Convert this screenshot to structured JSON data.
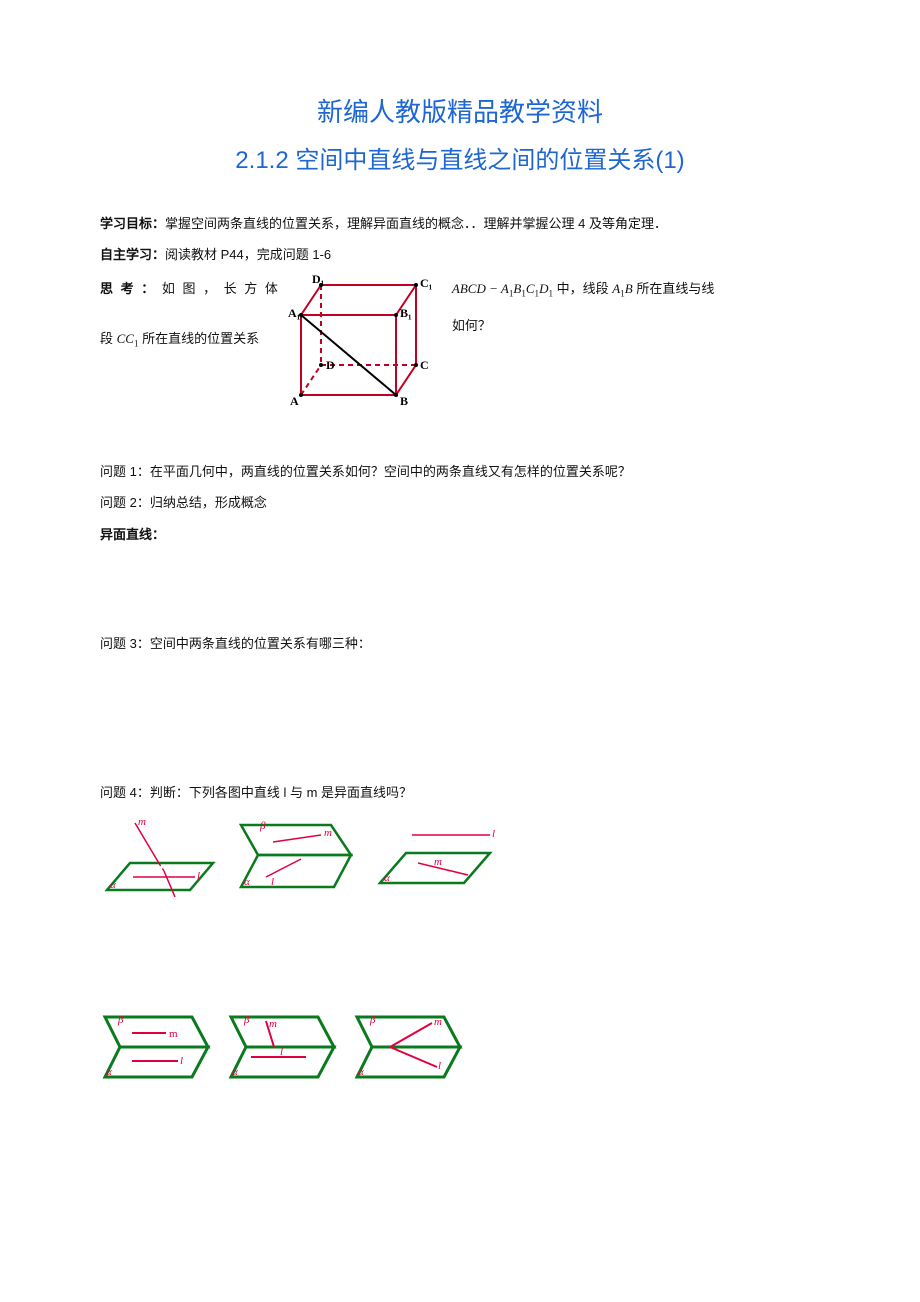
{
  "header": {
    "title_main": "新编人教版精品教学资料",
    "title_sub": "2.1.2 空间中直线与直线之间的位置关系(1)"
  },
  "objective": {
    "label": "学习目标：",
    "text": "掌握空间两条直线的位置关系，理解异面直线的概念．．理解并掌握公理 4 及等角定理．"
  },
  "self_study": {
    "label": "自主学习：",
    "text": "阅读教材 P44，完成问题 1-6"
  },
  "think": {
    "label": "思 考 ：",
    "pre_cube": " 如 图 ， 长 方 体",
    "post_cube_1_prefix": "",
    "math_abcd": "ABCD − A₁B₁C₁D₁",
    "in_text": " 中，线段 ",
    "math_a1b": "A₁B",
    "after_a1b": " 所在直线与线",
    "row2_pre": "段 ",
    "math_cc1": "CC₁",
    "row2_post": " 所在直线的位置关系",
    "row2_right": "如何？"
  },
  "cube_labels": {
    "D1": "D₁",
    "C1": "C₁",
    "A1": "A₁",
    "B1": "B₁",
    "D": "D",
    "C": "C",
    "A": "A",
    "B": "B"
  },
  "questions": {
    "q1": "问题 1：在平面几何中，两直线的位置关系如何？空间中的两条直线又有怎样的位置关系呢？",
    "q2": "问题 2：归纳总结，形成概念",
    "skew_label": "异面直线：",
    "q3": "问题 3：空间中两条直线的位置关系有哪三种：",
    "q4": "问题 4：判断：下列各图中直线 l 与 m 是异面直线吗？"
  },
  "plane_labels": {
    "alpha": "α",
    "beta": "β",
    "l": "l",
    "m": "m"
  }
}
